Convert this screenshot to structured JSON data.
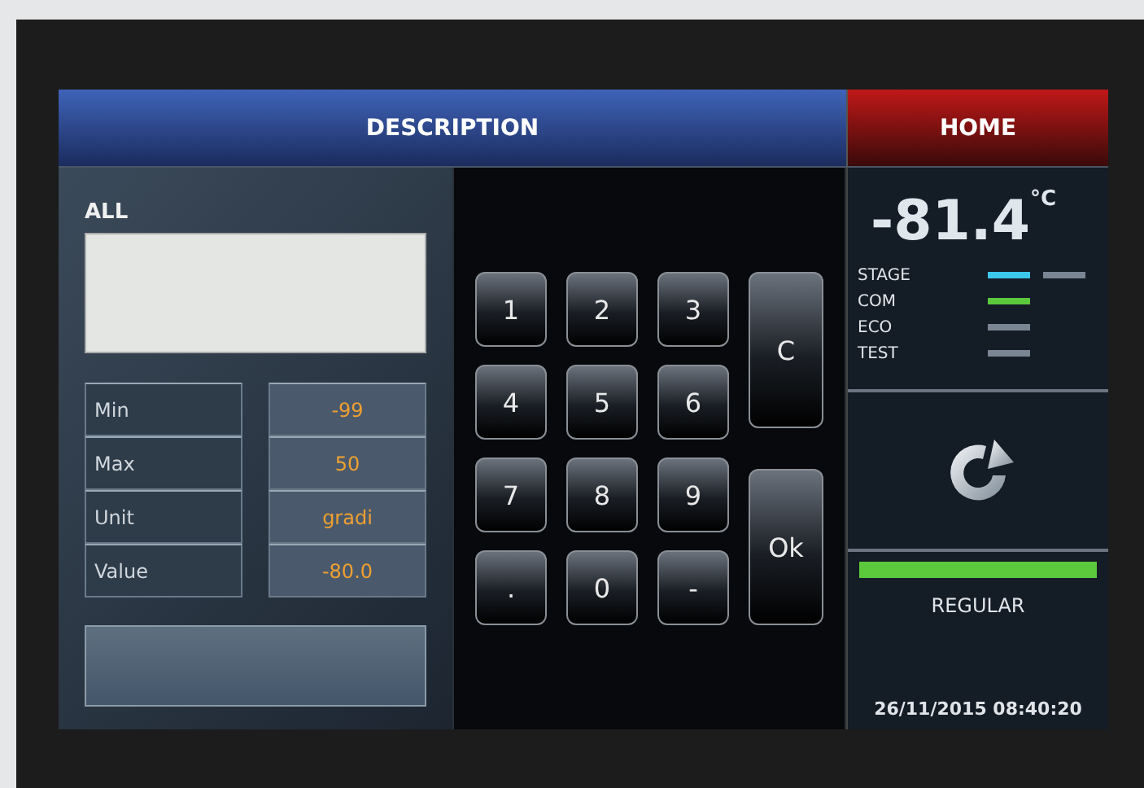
{
  "header": {
    "title": "DESCRIPTION",
    "home": "HOME"
  },
  "editor": {
    "label": "ALL",
    "params": [
      {
        "name": "Min",
        "value": "-99"
      },
      {
        "name": "Max",
        "value": "50"
      },
      {
        "name": "Unit",
        "value": "gradi"
      },
      {
        "name": "Value",
        "value": "-80.0"
      }
    ]
  },
  "keypad": {
    "keys": [
      "1",
      "2",
      "3",
      "4",
      "5",
      "6",
      "7",
      "8",
      "9",
      ".",
      "0",
      "-"
    ],
    "clear": "C",
    "ok": "Ok"
  },
  "status": {
    "temperature": "-81.4",
    "unit": "°C",
    "indicators": [
      {
        "name": "STAGE",
        "bars": [
          {
            "color": "#3cc8ec"
          },
          {
            "color": "#7a8594"
          }
        ]
      },
      {
        "name": "COM",
        "bars": [
          {
            "color": "#5cc83c"
          }
        ]
      },
      {
        "name": "ECO",
        "bars": [
          {
            "color": "#7a8594"
          }
        ]
      },
      {
        "name": "TEST",
        "bars": [
          {
            "color": "#7a8594"
          }
        ]
      }
    ],
    "mode": "REGULAR",
    "datetime": "26/11/2015 08:40:20"
  }
}
